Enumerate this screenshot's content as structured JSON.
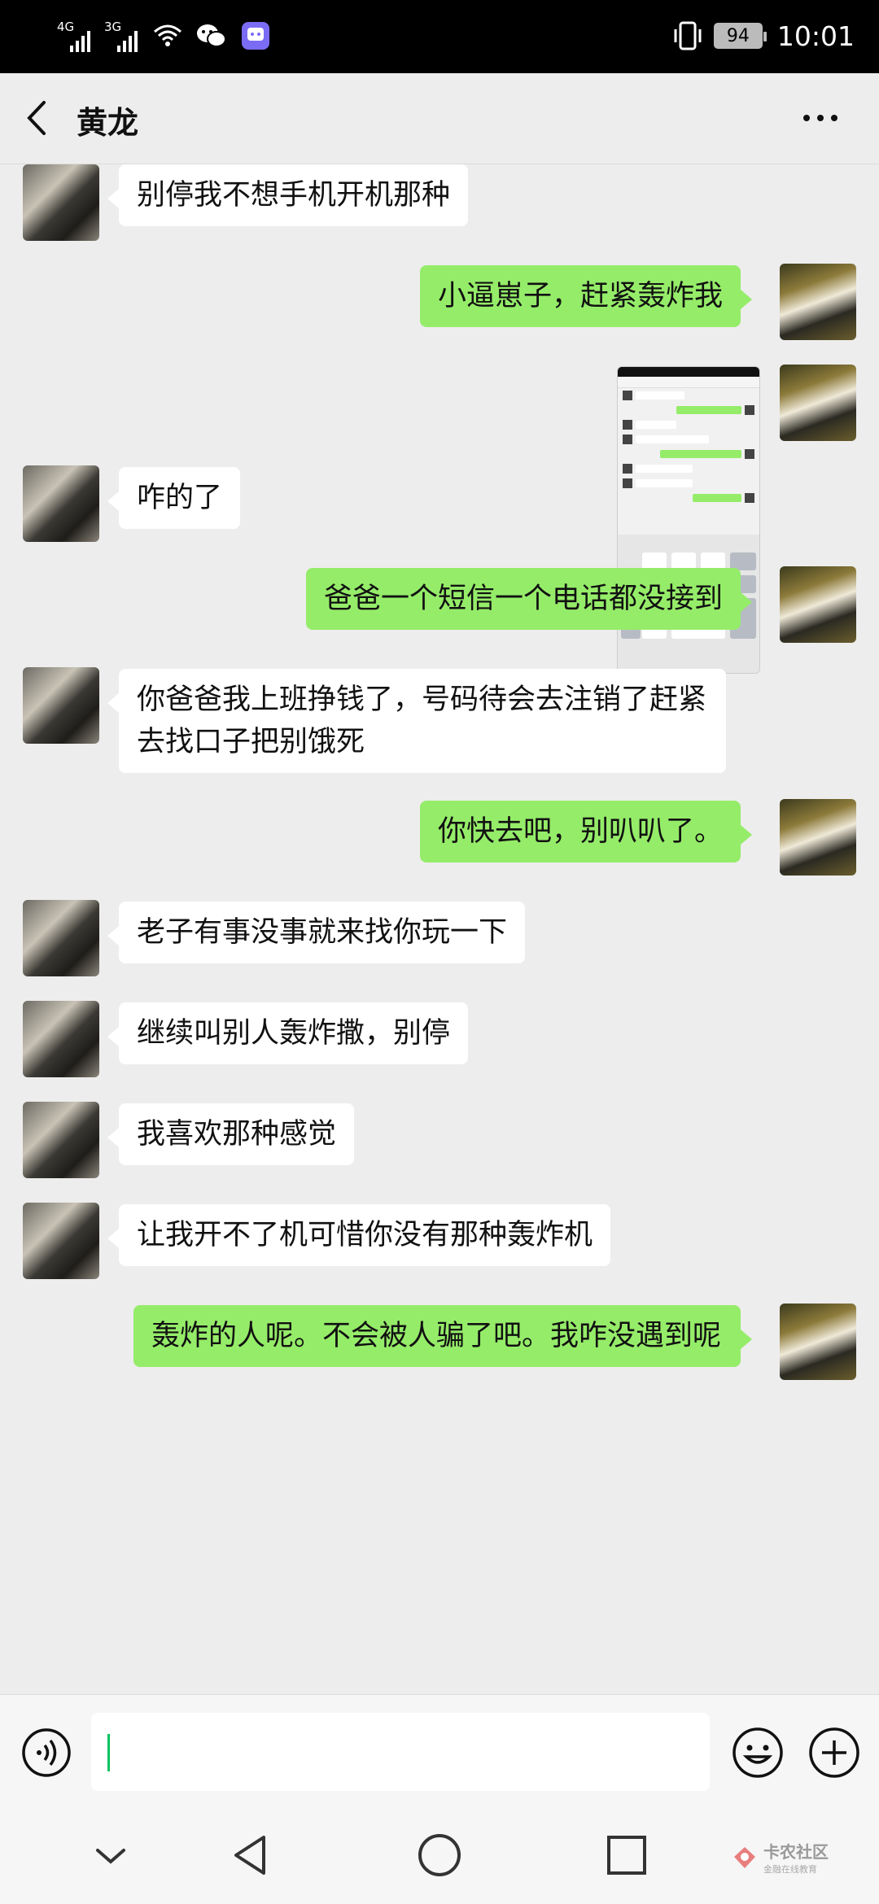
{
  "status_bar": {
    "network_1": "4G",
    "network_2": "3G",
    "battery": "94",
    "time": "10:01"
  },
  "header": {
    "title": "黄龙",
    "more_icon": "more-dots-icon",
    "back_icon": "back-arrow-icon"
  },
  "messages": [
    {
      "side": "in",
      "text": "别停我不想手机开机那种"
    },
    {
      "side": "out",
      "text": "小逼崽子，赶紧轰炸我"
    },
    {
      "side": "out",
      "type": "image",
      "text": ""
    },
    {
      "side": "in",
      "text": "咋的了"
    },
    {
      "side": "out",
      "text": "爸爸一个短信一个电话都没接到"
    },
    {
      "side": "in",
      "text": "你爸爸我上班挣钱了，号码待会去注销了赶紧去找口子把别饿死"
    },
    {
      "side": "out",
      "text": "你快去吧，别叭叭了。"
    },
    {
      "side": "in",
      "text": "老子有事没事就来找你玩一下"
    },
    {
      "side": "in",
      "text": "继续叫别人轰炸撒，别停"
    },
    {
      "side": "in",
      "text": "我喜欢那种感觉"
    },
    {
      "side": "in",
      "text": "让我开不了机可惜你没有那种轰炸机"
    },
    {
      "side": "out",
      "text": "轰炸的人呢。不会被人骗了吧。我咋没遇到呢"
    }
  ],
  "input_bar": {
    "value": "",
    "voice_icon": "voice-icon",
    "emoji_icon": "emoji-icon",
    "plus_icon": "plus-icon"
  },
  "watermark": {
    "name": "卡农社区",
    "sub": "金融在线教育"
  },
  "colors": {
    "outgoing_bubble": "#95ec69",
    "incoming_bubble": "#ffffff",
    "background": "#ededed",
    "caret": "#07c160"
  }
}
